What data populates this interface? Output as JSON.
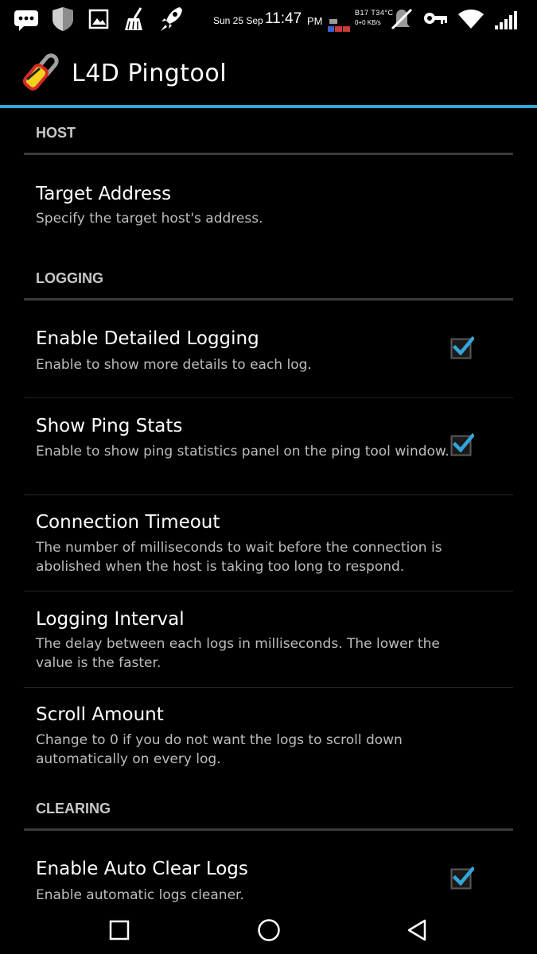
{
  "status_bar": {
    "date": "Sun 25 Sep",
    "time": "11:47",
    "ampm": "PM",
    "net_line1": "B17 T34°C",
    "net_line2": "0+0 KB/s",
    "icons": [
      "chat-icon",
      "shield-icon",
      "image-icon",
      "cleaner-broom-icon",
      "rocket-icon",
      "network-meter-icon",
      "mute-icon",
      "key-icon",
      "wifi-icon",
      "signal-icon"
    ]
  },
  "app_bar": {
    "title": "L4D Pingtool",
    "icon": "app-logo-icon"
  },
  "accent_color": "#33a6d8",
  "sections": [
    {
      "header": "HOST",
      "items": [
        {
          "title": "Target Address",
          "summary": "Specify the target host's address.",
          "checkbox": null
        }
      ]
    },
    {
      "header": "LOGGING",
      "items": [
        {
          "title": "Enable Detailed Logging",
          "summary": "Enable to show more details to each log.",
          "checkbox": true
        },
        {
          "title": "Show Ping Stats",
          "summary": "Enable to show ping statistics panel on the ping tool window.",
          "checkbox": true
        },
        {
          "title": "Connection Timeout",
          "summary": "The number of milliseconds to wait before the connection is abolished when the host is taking too long to respond.",
          "checkbox": null
        },
        {
          "title": "Logging Interval",
          "summary": "The delay between each logs in milliseconds. The lower the value is the faster.",
          "checkbox": null
        },
        {
          "title": "Scroll Amount",
          "summary": "Change to 0 if you do not want the logs to scroll down automatically on every log.",
          "checkbox": null
        }
      ]
    },
    {
      "header": "CLEARING",
      "items": [
        {
          "title": "Enable Auto Clear Logs",
          "summary": "Enable automatic logs cleaner.",
          "checkbox": true
        }
      ]
    }
  ],
  "nav_bar": {
    "icons": [
      "recents-square-icon",
      "home-circle-icon",
      "back-triangle-icon"
    ]
  }
}
